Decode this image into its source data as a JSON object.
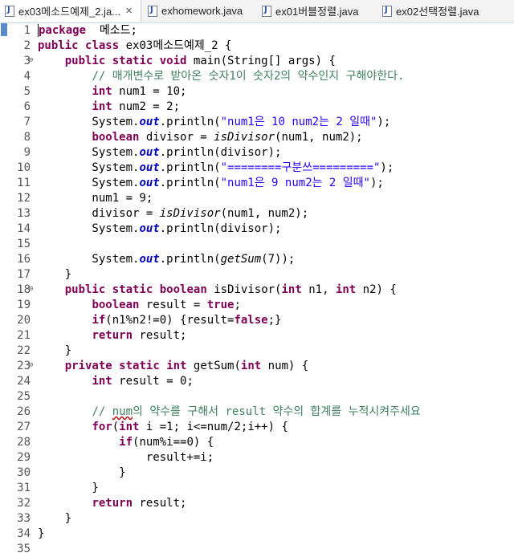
{
  "tabs": [
    {
      "label": "ex03메소드예제_2.ja...",
      "active": true,
      "closable": true
    },
    {
      "label": "exhomework.java",
      "active": false
    },
    {
      "label": "ex01버블정렬.java",
      "active": false
    },
    {
      "label": "ex02선택정렬.java",
      "active": false
    }
  ],
  "editor": {
    "line_numbers": [
      "1",
      "2",
      "3",
      "4",
      "5",
      "6",
      "7",
      "8",
      "9",
      "10",
      "11",
      "12",
      "13",
      "14",
      "15",
      "16",
      "17",
      "18",
      "19",
      "20",
      "21",
      "22",
      "23",
      "24",
      "25",
      "26",
      "27",
      "28",
      "29",
      "30",
      "31",
      "32",
      "33",
      "34",
      "35"
    ],
    "fold_lines": [
      3,
      18,
      23
    ],
    "lines": [
      [
        [
          "kw",
          "package"
        ],
        [
          "",
          "  메소드;"
        ]
      ],
      [
        [
          "kw",
          "public"
        ],
        [
          "",
          " "
        ],
        [
          "kw",
          "class"
        ],
        [
          "",
          " ex03메소드예제_2 {"
        ]
      ],
      [
        [
          "",
          "    "
        ],
        [
          "kw",
          "public"
        ],
        [
          "",
          " "
        ],
        [
          "kw",
          "static"
        ],
        [
          "",
          " "
        ],
        [
          "kw",
          "void"
        ],
        [
          "",
          " main(String[] args) {"
        ]
      ],
      [
        [
          "",
          "        "
        ],
        [
          "cm",
          "// 매개변수로 받아온 숫자1이 숫자2의 약수인지 구해야한다."
        ]
      ],
      [
        [
          "",
          "        "
        ],
        [
          "kw",
          "int"
        ],
        [
          "",
          " num1 = 10;"
        ]
      ],
      [
        [
          "",
          "        "
        ],
        [
          "kw",
          "int"
        ],
        [
          "",
          " num2 = 2;"
        ]
      ],
      [
        [
          "",
          "        System."
        ],
        [
          "sf",
          "out"
        ],
        [
          "",
          ".println("
        ],
        [
          "st",
          "\"num1은 10 num2는 2 일때\""
        ],
        [
          "",
          ");"
        ]
      ],
      [
        [
          "",
          "        "
        ],
        [
          "kw",
          "boolean"
        ],
        [
          "",
          " divisor = "
        ],
        [
          "it",
          "isDivisor"
        ],
        [
          "",
          "(num1, num2);"
        ]
      ],
      [
        [
          "",
          "        System."
        ],
        [
          "sf",
          "out"
        ],
        [
          "",
          ".println(divisor);"
        ]
      ],
      [
        [
          "",
          "        System."
        ],
        [
          "sf",
          "out"
        ],
        [
          "",
          ".println("
        ],
        [
          "st",
          "\"========구분쓰=========\""
        ],
        [
          "",
          ");"
        ]
      ],
      [
        [
          "",
          "        System."
        ],
        [
          "sf",
          "out"
        ],
        [
          "",
          ".println("
        ],
        [
          "st",
          "\"num1은 9 num2는 2 일때\""
        ],
        [
          "",
          ");"
        ]
      ],
      [
        [
          "",
          "        num1 = 9;"
        ]
      ],
      [
        [
          "",
          "        divisor = "
        ],
        [
          "it",
          "isDivisor"
        ],
        [
          "",
          "(num1, num2);"
        ]
      ],
      [
        [
          "",
          "        System."
        ],
        [
          "sf",
          "out"
        ],
        [
          "",
          ".println(divisor);"
        ]
      ],
      [
        [
          "",
          ""
        ]
      ],
      [
        [
          "",
          "        System."
        ],
        [
          "sf",
          "out"
        ],
        [
          "",
          ".println("
        ],
        [
          "it",
          "getSum"
        ],
        [
          "",
          "(7));"
        ]
      ],
      [
        [
          "",
          "    }"
        ]
      ],
      [
        [
          "",
          "    "
        ],
        [
          "kw",
          "public"
        ],
        [
          "",
          " "
        ],
        [
          "kw",
          "static"
        ],
        [
          "",
          " "
        ],
        [
          "kw",
          "boolean"
        ],
        [
          "",
          " isDivisor("
        ],
        [
          "kw",
          "int"
        ],
        [
          "",
          " n1, "
        ],
        [
          "kw",
          "int"
        ],
        [
          "",
          " n2) {"
        ]
      ],
      [
        [
          "",
          "        "
        ],
        [
          "kw",
          "boolean"
        ],
        [
          "",
          " result = "
        ],
        [
          "kw",
          "true"
        ],
        [
          "",
          ";"
        ]
      ],
      [
        [
          "",
          "        "
        ],
        [
          "kw",
          "if"
        ],
        [
          "",
          "(n1%n2!=0) {result="
        ],
        [
          "kw",
          "false"
        ],
        [
          "",
          ";}"
        ]
      ],
      [
        [
          "",
          "        "
        ],
        [
          "kw",
          "return"
        ],
        [
          "",
          " result;"
        ]
      ],
      [
        [
          "",
          "    }"
        ]
      ],
      [
        [
          "",
          "    "
        ],
        [
          "kw",
          "private"
        ],
        [
          "",
          " "
        ],
        [
          "kw",
          "static"
        ],
        [
          "",
          " "
        ],
        [
          "kw",
          "int"
        ],
        [
          "",
          " getSum("
        ],
        [
          "kw",
          "int"
        ],
        [
          "",
          " num) {"
        ]
      ],
      [
        [
          "",
          "        "
        ],
        [
          "kw",
          "int"
        ],
        [
          "",
          " result = 0;"
        ]
      ],
      [
        [
          "",
          ""
        ]
      ],
      [
        [
          "",
          "        "
        ],
        [
          "cm",
          "// "
        ],
        [
          "cmul",
          "num"
        ],
        [
          "cm",
          "의 약수를 구해서 result 약수의 합계를 누적시켜주세요"
        ]
      ],
      [
        [
          "",
          "        "
        ],
        [
          "kw",
          "for"
        ],
        [
          "",
          "("
        ],
        [
          "kw",
          "int"
        ],
        [
          "",
          " i =1; i<=num/2;i++) {"
        ]
      ],
      [
        [
          "",
          "            "
        ],
        [
          "kw",
          "if"
        ],
        [
          "",
          "(num%i==0) {"
        ]
      ],
      [
        [
          "",
          "                result+=i;"
        ]
      ],
      [
        [
          "",
          "            }"
        ]
      ],
      [
        [
          "",
          "        }"
        ]
      ],
      [
        [
          "",
          "        "
        ],
        [
          "kw",
          "return"
        ],
        [
          "",
          " result;"
        ]
      ],
      [
        [
          "",
          "    }"
        ]
      ],
      [
        [
          "",
          "}"
        ]
      ],
      [
        [
          "",
          ""
        ]
      ]
    ]
  }
}
